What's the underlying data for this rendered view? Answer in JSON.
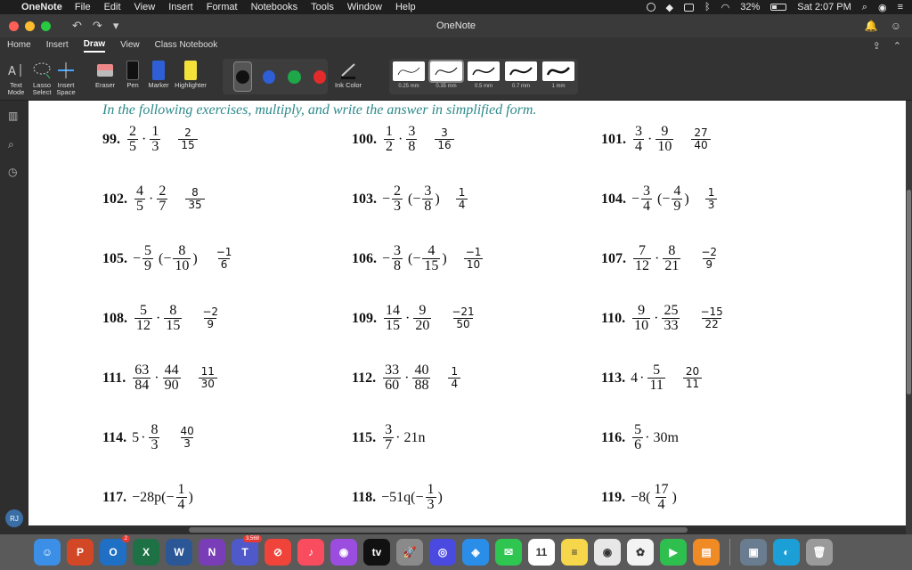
{
  "menubar": {
    "app": "OneNote",
    "items": [
      "File",
      "Edit",
      "View",
      "Insert",
      "Format",
      "Notebooks",
      "Tools",
      "Window",
      "Help"
    ],
    "battery": "32%",
    "clock": "Sat 2:07 PM"
  },
  "window": {
    "title": "OneNote"
  },
  "tabs": [
    "Home",
    "Insert",
    "Draw",
    "View",
    "Class Notebook"
  ],
  "active_tab": "Draw",
  "ribbon": {
    "tools": [
      "Text Mode",
      "Lasso Select",
      "Insert Space",
      "Eraser",
      "Pen",
      "Marker",
      "Highlighter"
    ],
    "ink_color_label": "Ink Color",
    "colors": [
      "#111111",
      "#2f5fd6",
      "#1ea84a",
      "#e32b2b"
    ],
    "thickness": [
      "0.25 mm",
      "0.35 mm",
      "0.5 mm",
      "0.7 mm",
      "1 mm"
    ],
    "selected_thickness": "0.35 mm"
  },
  "page": {
    "instruction": "In the following exercises, multiply, and write the answer in simplified form.",
    "exercises": [
      {
        "num": "99.",
        "expr": [
          [
            "2",
            "5"
          ],
          [
            "1",
            "3"
          ]
        ],
        "ans": [
          "2",
          "15"
        ]
      },
      {
        "num": "100.",
        "expr": [
          [
            "1",
            "2"
          ],
          [
            "3",
            "8"
          ]
        ],
        "ans": [
          "3",
          "16"
        ]
      },
      {
        "num": "101.",
        "expr": [
          [
            "3",
            "4"
          ],
          [
            "9",
            "10"
          ]
        ],
        "ans": [
          "27",
          "40"
        ]
      },
      {
        "num": "102.",
        "expr": [
          [
            "4",
            "5"
          ],
          [
            "2",
            "7"
          ]
        ],
        "ans": [
          "8",
          "35"
        ]
      },
      {
        "num": "103.",
        "prefix": "−",
        "expr": [
          [
            "2",
            "3"
          ],
          [
            "3",
            "8"
          ]
        ],
        "ans": [
          "1",
          "4"
        ]
      },
      {
        "num": "104.",
        "prefix": "−",
        "expr": [
          [
            "3",
            "4"
          ],
          [
            "4",
            "9"
          ]
        ],
        "ans": [
          "1",
          "3"
        ]
      },
      {
        "num": "105.",
        "prefix": "−",
        "expr": [
          [
            "5",
            "9"
          ],
          [
            "8",
            "10"
          ]
        ],
        "ans": [
          "−1",
          "6"
        ]
      },
      {
        "num": "106.",
        "prefix": "−",
        "expr": [
          [
            "3",
            "8"
          ],
          [
            "4",
            "15"
          ]
        ],
        "ans": [
          "−1",
          "10"
        ]
      },
      {
        "num": "107.",
        "expr": [
          [
            "7",
            "12"
          ],
          [
            "8",
            "21"
          ]
        ],
        "ans": [
          "−2",
          "9"
        ]
      },
      {
        "num": "108.",
        "expr": [
          [
            "5",
            "12"
          ],
          [
            "8",
            "15"
          ]
        ],
        "ans": [
          "−2",
          "9"
        ]
      },
      {
        "num": "109.",
        "expr": [
          [
            "14",
            "15"
          ],
          [
            "9",
            "20"
          ]
        ],
        "ans": [
          "−21",
          "50"
        ]
      },
      {
        "num": "110.",
        "expr": [
          [
            "9",
            "10"
          ],
          [
            "25",
            "33"
          ]
        ],
        "ans": [
          "−15",
          "22"
        ]
      },
      {
        "num": "111.",
        "expr": [
          [
            "63",
            "84"
          ],
          [
            "44",
            "90"
          ]
        ],
        "ans": [
          "11",
          "30"
        ]
      },
      {
        "num": "112.",
        "expr": [
          [
            "33",
            "60"
          ],
          [
            "40",
            "88"
          ]
        ],
        "ans": [
          "1",
          "4"
        ]
      },
      {
        "num": "113.",
        "whole": "4",
        "expr": [
          [
            "5",
            "11"
          ]
        ],
        "ans": [
          "20",
          "11"
        ]
      },
      {
        "num": "114.",
        "whole": "5",
        "expr": [
          [
            "8",
            "3"
          ]
        ],
        "ans": [
          "40",
          "3"
        ]
      },
      {
        "num": "115.",
        "expr": [
          [
            "3",
            "7"
          ]
        ],
        "suffix": "· 21n"
      },
      {
        "num": "116.",
        "expr": [
          [
            "5",
            "6"
          ]
        ],
        "suffix": "· 30m"
      },
      {
        "num": "117.",
        "pre": "−28p",
        "expr": [
          [
            "1",
            "4"
          ]
        ],
        "neg": true
      },
      {
        "num": "118.",
        "pre": "−51q",
        "expr": [
          [
            "1",
            "3"
          ]
        ],
        "neg": true
      },
      {
        "num": "119.",
        "pre": "−8",
        "expr": [
          [
            "17",
            "4"
          ]
        ]
      }
    ]
  },
  "user_initials": "RJ",
  "dock": [
    {
      "name": "finder",
      "color": "#3b8fe6",
      "label": "☺"
    },
    {
      "name": "powerpoint",
      "color": "#d24726",
      "label": "P"
    },
    {
      "name": "outlook",
      "color": "#1f6fc4",
      "label": "O",
      "badge": "2"
    },
    {
      "name": "excel",
      "color": "#1e7145",
      "label": "X"
    },
    {
      "name": "word",
      "color": "#2b5797",
      "label": "W"
    },
    {
      "name": "onenote",
      "color": "#7a3db8",
      "label": "N"
    },
    {
      "name": "teams",
      "color": "#5059c9",
      "label": "T",
      "badge": "3,568"
    },
    {
      "name": "news",
      "color": "#f0433a",
      "label": "⊘"
    },
    {
      "name": "music",
      "color": "#f94c5e",
      "label": "♪"
    },
    {
      "name": "podcasts",
      "color": "#9b4de0",
      "label": "◉"
    },
    {
      "name": "tv",
      "color": "#111111",
      "label": "tv"
    },
    {
      "name": "launchpad",
      "color": "#8a8a8a",
      "label": "🚀"
    },
    {
      "name": "siri",
      "color": "#4a4ae0",
      "label": "◎"
    },
    {
      "name": "safari",
      "color": "#2a8ee8",
      "label": "◈"
    },
    {
      "name": "messages",
      "color": "#2fc551",
      "label": "✉"
    },
    {
      "name": "calendar",
      "color": "#ffffff",
      "label": "11"
    },
    {
      "name": "notes",
      "color": "#f6d64a",
      "label": "≡"
    },
    {
      "name": "chrome",
      "color": "#e7e7e7",
      "label": "◉"
    },
    {
      "name": "photos",
      "color": "#f3f3f3",
      "label": "✿"
    },
    {
      "name": "facetime",
      "color": "#2fbf4f",
      "label": "▶"
    },
    {
      "name": "books",
      "color": "#f08a24",
      "label": "▤"
    },
    {
      "name": "preview",
      "color": "#6a7c8f",
      "label": "▣"
    },
    {
      "name": "webex",
      "color": "#1b9fd6",
      "label": "◐"
    },
    {
      "name": "trash",
      "color": "#9a9a9a",
      "label": "🗑"
    }
  ]
}
